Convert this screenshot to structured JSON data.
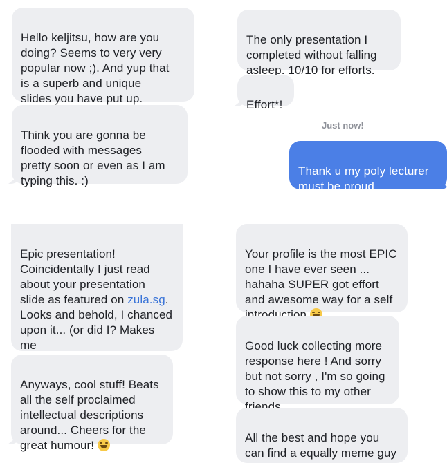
{
  "messages": {
    "m1": "Hello keljitsu, how are you\ndoing? Seems to very very\npopular now ;). And yup that\nis a superb and unique\nslides you have put up.",
    "m2": "Think you are gonna be\nflooded with messages\npretty soon or even as I am\ntyping this. :)",
    "m3": "The only presentation I\ncompleted without falling\nasleep. 10/10 for efforts.",
    "m4": "Effort*!",
    "timestamp": "Just now!",
    "m5": "Thank u my poly lecturer\nmust be proud",
    "m6_before": "Epic presentation!\nCoincidentally I just read\nabout your presentation\nslide as featured on ",
    "m6_link": "zula.sg",
    "m6_after": ".\nLooks and behold, I chanced\nupon it... (or did I? Makes me\nwonder how the algorithms\nwork)",
    "m7": "Anyways, cool stuff! Beats\nall the self proclaimed\nintellectual descriptions\naround... Cheers for the\ngreat humour! ",
    "m8": "Your profile is the most EPIC\none I have ever seen ...\nhahaha SUPER got effort\nand awesome way for a self\nintroduction ",
    "m9": "Good luck collecting more\nresponse here ! And sorry\nbut not sorry , I'm so going\nto show this to my other\nfriends ...",
    "m10": "All the best and hope you\ncan find a equally meme guy"
  },
  "emoji_icon": "laughing-emoji",
  "colors": {
    "received_bubble": "#edeef1",
    "sent_bubble": "#4b7fe6",
    "link": "#3a74d8"
  }
}
